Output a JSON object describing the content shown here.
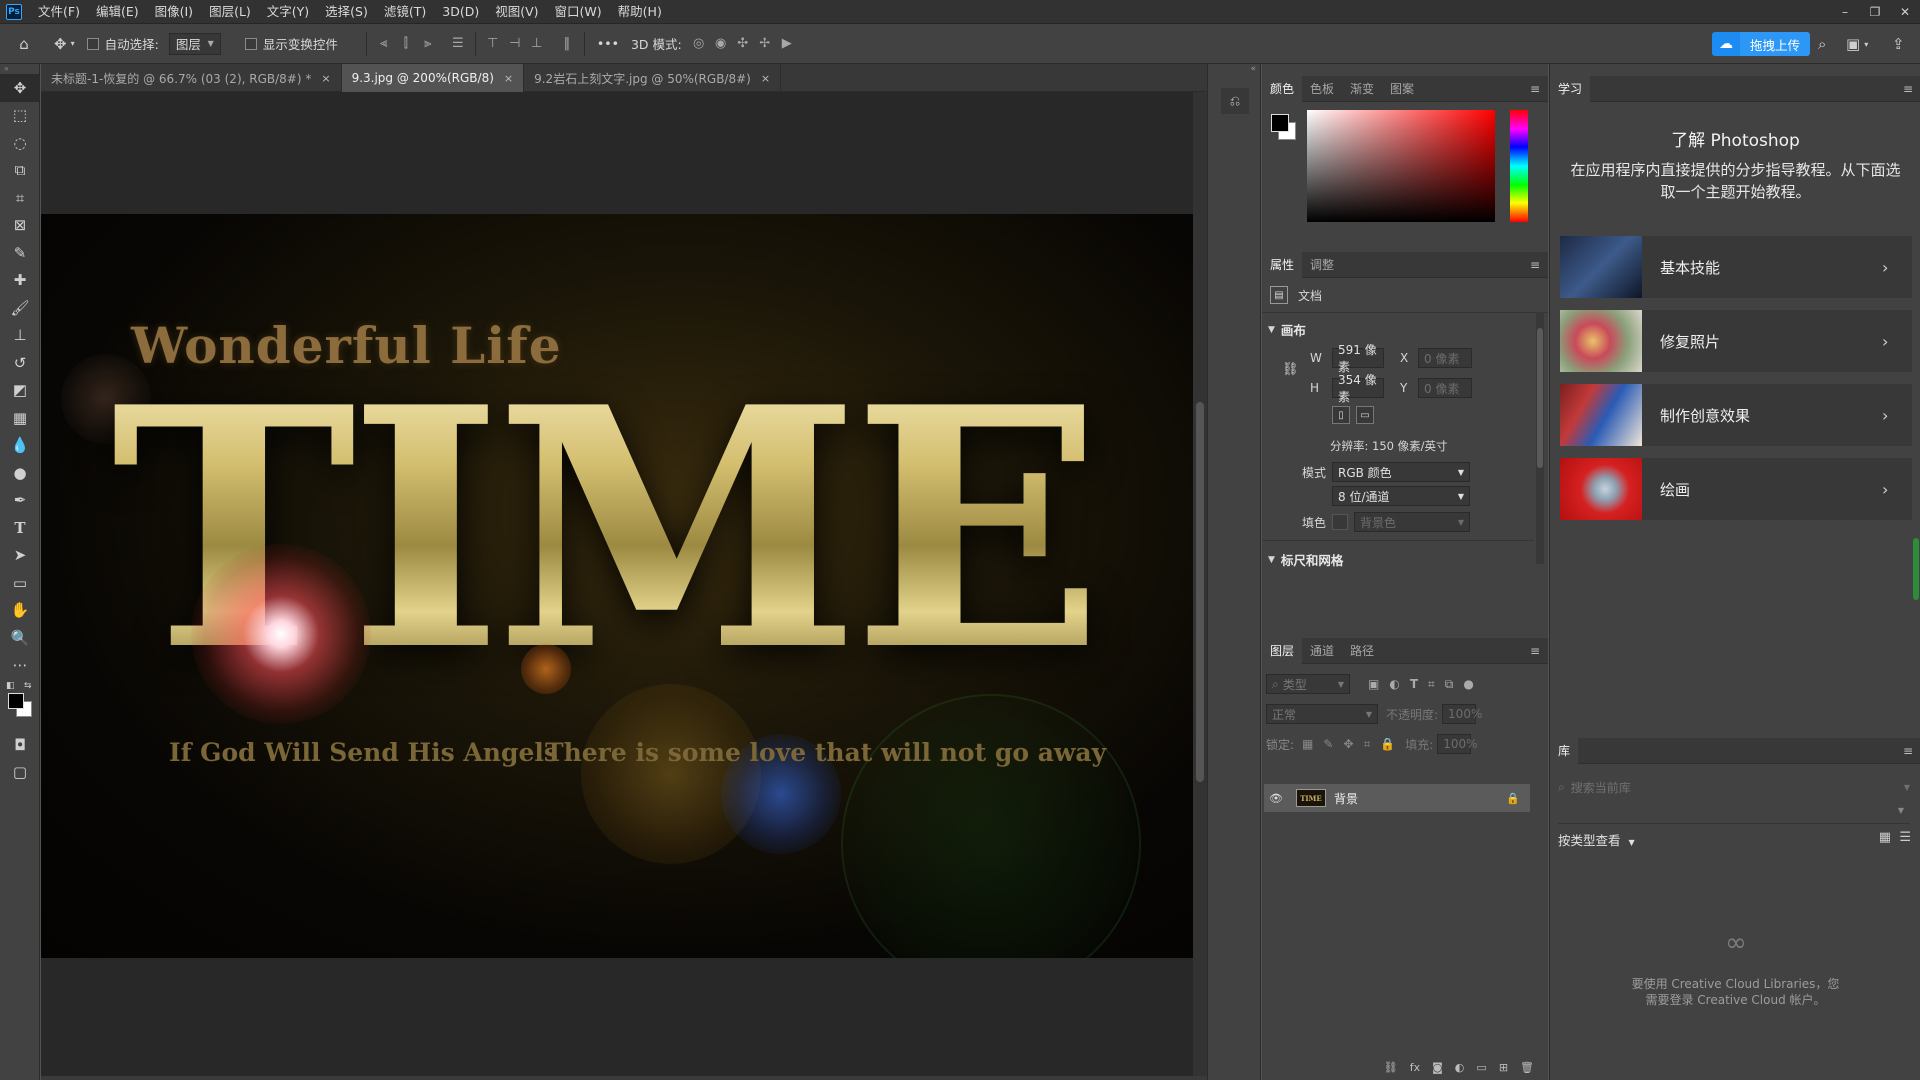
{
  "app": {
    "logo": "Ps"
  },
  "menu": [
    "文件(F)",
    "编辑(E)",
    "图像(I)",
    "图层(L)",
    "文字(Y)",
    "选择(S)",
    "滤镜(T)",
    "3D(D)",
    "视图(V)",
    "窗口(W)",
    "帮助(H)"
  ],
  "window_controls": {
    "minimize": "–",
    "restore": "❐",
    "close": "✕"
  },
  "options": {
    "auto_select_label": "自动选择:",
    "auto_select_value": "图层",
    "show_transform_label": "显示变换控件",
    "more": "•••",
    "mode3d_label": "3D 模式:",
    "upload_label": "拖拽上传"
  },
  "tabs": [
    {
      "label": "未标题-1-恢复的 @ 66.7% (03 (2), RGB/8#) *",
      "close": "×"
    },
    {
      "label": "9.3.jpg @ 200%(RGB/8)",
      "close": "×"
    },
    {
      "label": "9.2岩石上刻文字.jpg @ 50%(RGB/8#)",
      "close": "×"
    }
  ],
  "artwork": {
    "subtitle": "Wonderful Life",
    "main": "TIME",
    "tagline_left": "If God Will Send His Angels",
    "tagline_right": "There is some love that will not go away"
  },
  "color_panel": {
    "tabs": [
      "颜色",
      "色板",
      "渐变",
      "图案"
    ]
  },
  "properties_panel": {
    "tabs": [
      "属性",
      "调整"
    ],
    "doc_label": "文档",
    "canvas_title": "画布",
    "w_label": "W",
    "w_value": "591 像素",
    "x_label": "X",
    "x_value": "0 像素",
    "h_label": "H",
    "h_value": "354 像素",
    "y_label": "Y",
    "y_value": "0 像素",
    "resolution": "分辨率: 150 像素/英寸",
    "mode_label": "模式",
    "mode_value": "RGB 颜色",
    "depth_value": "8 位/通道",
    "fill_label": "填色",
    "fill_value": "背景色",
    "rulers_title": "标尺和网格"
  },
  "layers_panel": {
    "tabs": [
      "图层",
      "通道",
      "路径"
    ],
    "filter_placeholder": "类型",
    "blend_mode": "正常",
    "opacity_label": "不透明度:",
    "opacity_value": "100%",
    "lock_label": "锁定:",
    "fill_label": "填充:",
    "fill_value": "100%",
    "layer_name": "背景",
    "layer_thumb_text": "TIME"
  },
  "learn_panel": {
    "tab": "学习",
    "title": "了解 Photoshop",
    "description": "在应用程序内直接提供的分步指导教程。从下面选取一个主题开始教程。",
    "cards": [
      {
        "label": "基本技能",
        "chevron": "›"
      },
      {
        "label": "修复照片",
        "chevron": "›"
      },
      {
        "label": "制作创意效果",
        "chevron": "›"
      },
      {
        "label": "绘画",
        "chevron": "›"
      }
    ]
  },
  "library_panel": {
    "tab": "库",
    "search_placeholder": "搜索当前库",
    "view_label": "按类型查看",
    "empty_line1": "要使用 Creative Cloud Libraries，您",
    "empty_line2": "需要登录 Creative Cloud 帐户。"
  },
  "colors": {
    "accent_blue": "#2c97f5",
    "panel_bg": "#424242",
    "canvas_bg": "#282828"
  }
}
